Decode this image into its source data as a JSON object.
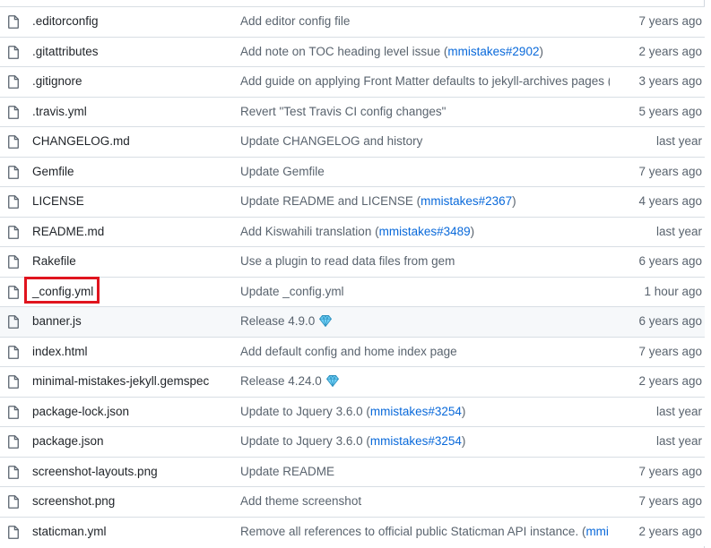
{
  "files": [
    {
      "name": ".editorconfig",
      "message": "Add editor config file",
      "link": "",
      "suffix": "",
      "gem": false,
      "age": "7 years ago"
    },
    {
      "name": ".gitattributes",
      "message": "Add note on TOC heading level issue (",
      "link": "mmistakes#2902",
      "suffix": ")",
      "gem": false,
      "age": "2 years ago"
    },
    {
      "name": ".gitignore",
      "message": "Add guide on applying Front Matter defaults to jekyll-archives pages (",
      "link": "m...",
      "suffix": "",
      "gem": false,
      "age": "3 years ago"
    },
    {
      "name": ".travis.yml",
      "message": "Revert \"Test Travis CI config changes\"",
      "link": "",
      "suffix": "",
      "gem": false,
      "age": "5 years ago"
    },
    {
      "name": "CHANGELOG.md",
      "message": "Update CHANGELOG and history",
      "link": "",
      "suffix": "",
      "gem": false,
      "age": "last year"
    },
    {
      "name": "Gemfile",
      "message": "Update Gemfile",
      "link": "",
      "suffix": "",
      "gem": false,
      "age": "7 years ago"
    },
    {
      "name": "LICENSE",
      "message": "Update README and LICENSE (",
      "link": "mmistakes#2367",
      "suffix": ")",
      "gem": false,
      "age": "4 years ago"
    },
    {
      "name": "README.md",
      "message": "Add Kiswahili translation (",
      "link": "mmistakes#3489",
      "suffix": ")",
      "gem": false,
      "age": "last year"
    },
    {
      "name": "Rakefile",
      "message": "Use a plugin to read data files from gem",
      "link": "",
      "suffix": "",
      "gem": false,
      "age": "6 years ago"
    },
    {
      "name": "_config.yml",
      "message": "Update _config.yml",
      "link": "",
      "suffix": "",
      "gem": false,
      "age": "1 hour ago"
    },
    {
      "name": "banner.js",
      "message": "Release 4.9.0",
      "link": "",
      "suffix": "",
      "gem": true,
      "age": "6 years ago"
    },
    {
      "name": "index.html",
      "message": "Add default config and home index page",
      "link": "",
      "suffix": "",
      "gem": false,
      "age": "7 years ago"
    },
    {
      "name": "minimal-mistakes-jekyll.gemspec",
      "message": "Release 4.24.0",
      "link": "",
      "suffix": "",
      "gem": true,
      "age": "2 years ago"
    },
    {
      "name": "package-lock.json",
      "message": "Update to Jquery 3.6.0 (",
      "link": "mmistakes#3254",
      "suffix": ")",
      "gem": false,
      "age": "last year"
    },
    {
      "name": "package.json",
      "message": "Update to Jquery 3.6.0 (",
      "link": "mmistakes#3254",
      "suffix": ")",
      "gem": false,
      "age": "last year"
    },
    {
      "name": "screenshot-layouts.png",
      "message": "Update README",
      "link": "",
      "suffix": "",
      "gem": false,
      "age": "7 years ago"
    },
    {
      "name": "screenshot.png",
      "message": "Add theme screenshot",
      "link": "",
      "suffix": "",
      "gem": false,
      "age": "7 years ago"
    },
    {
      "name": "staticman.yml",
      "message": "Remove all references to official public Staticman API instance. (",
      "link": "mmi...",
      "suffix": "",
      "gem": false,
      "age": "2 years ago"
    }
  ],
  "icons": {
    "file": "file-icon",
    "gem": "gem-icon"
  },
  "colors": {
    "link": "#0969da",
    "highlight": "#e0141e",
    "muted": "#59636e"
  }
}
